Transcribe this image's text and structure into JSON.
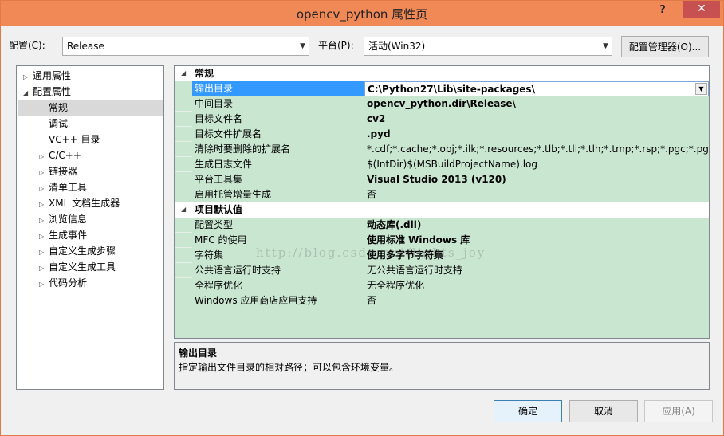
{
  "window": {
    "title": "opencv_python 属性页",
    "help": "?",
    "close": "✕"
  },
  "toolbar": {
    "config_label": "配置(C):",
    "config_value": "Release",
    "platform_label": "平台(P):",
    "platform_value": "活动(Win32)",
    "config_manager_label": "配置管理器(O)..."
  },
  "tree": {
    "items": [
      {
        "label": "通用属性",
        "expander": "▷"
      },
      {
        "label": "配置属性",
        "expander": "◢"
      },
      {
        "label": "常规",
        "expander": ""
      },
      {
        "label": "调试",
        "expander": ""
      },
      {
        "label": "VC++ 目录",
        "expander": ""
      },
      {
        "label": "C/C++",
        "expander": "▷"
      },
      {
        "label": "链接器",
        "expander": "▷"
      },
      {
        "label": "清单工具",
        "expander": "▷"
      },
      {
        "label": "XML 文档生成器",
        "expander": "▷"
      },
      {
        "label": "浏览信息",
        "expander": "▷"
      },
      {
        "label": "生成事件",
        "expander": "▷"
      },
      {
        "label": "自定义生成步骤",
        "expander": "▷"
      },
      {
        "label": "自定义生成工具",
        "expander": "▷"
      },
      {
        "label": "代码分析",
        "expander": "▷"
      }
    ]
  },
  "grid": {
    "categories": [
      {
        "label": "常规",
        "expander": "◢"
      },
      {
        "label": "项目默认值",
        "expander": "◢"
      }
    ],
    "general": [
      {
        "name": "输出目录",
        "value": "C:\\Python27\\Lib\\site-packages\\"
      },
      {
        "name": "中间目录",
        "value": "opencv_python.dir\\Release\\"
      },
      {
        "name": "目标文件名",
        "value": "cv2"
      },
      {
        "name": "目标文件扩展名",
        "value": ".pyd"
      },
      {
        "name": "清除时要删除的扩展名",
        "value": "*.cdf;*.cache;*.obj;*.ilk;*.resources;*.tlb;*.tli;*.tlh;*.tmp;*.rsp;*.pgc;*.pgd;*.met"
      },
      {
        "name": "生成日志文件",
        "value": "$(IntDir)$(MSBuildProjectName).log"
      },
      {
        "name": "平台工具集",
        "value": "Visual Studio 2013 (v120)"
      },
      {
        "name": "启用托管增量生成",
        "value": "否"
      }
    ],
    "defaults": [
      {
        "name": "配置类型",
        "value": "动态库(.dll)"
      },
      {
        "name": "MFC 的使用",
        "value": "使用标准 Windows 库"
      },
      {
        "name": "字符集",
        "value": "使用多字节字符集"
      },
      {
        "name": "公共语言运行时支持",
        "value": "无公共语言运行时支持"
      },
      {
        "name": "全程序优化",
        "value": "无全程序优化"
      },
      {
        "name": "Windows 应用商店应用支持",
        "value": "否"
      }
    ]
  },
  "description": {
    "title": "输出目录",
    "text": "指定输出文件目录的相对路径；可以包含环境变量。"
  },
  "watermark": "http://blog.csdn.net/lights_joy",
  "buttons": {
    "ok": "确定",
    "cancel": "取消",
    "apply": "应用(A)"
  },
  "colors": {
    "titlebar": "#f08956",
    "grid_bg": "#c9e6d1",
    "selection": "#3399ff",
    "close": "#c75050"
  }
}
